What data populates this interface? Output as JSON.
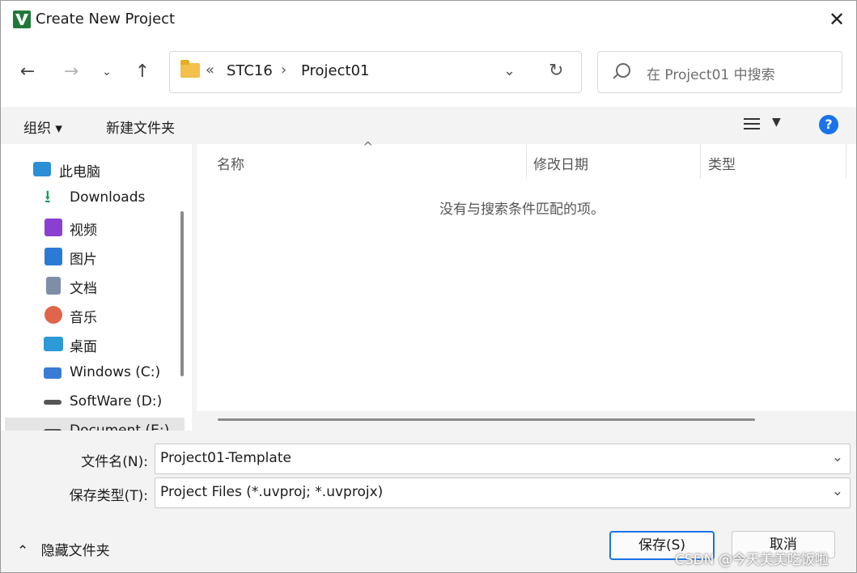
{
  "window": {
    "title": "Create New Project"
  },
  "address": {
    "overflow": "«",
    "crumbs": [
      "STC16",
      "Project01"
    ],
    "separator": "›"
  },
  "search": {
    "placeholder": "在 Project01 中搜索"
  },
  "toolbar": {
    "organize": "组织 ▾",
    "new_folder": "新建文件夹",
    "help": "?"
  },
  "tree": {
    "items": [
      {
        "label": "此电脑",
        "icon": "computer-icon",
        "color": "#2b8fd6"
      },
      {
        "label": "Downloads",
        "icon": "download-icon",
        "color": "#1a9c5b"
      },
      {
        "label": "视频",
        "icon": "video-icon",
        "color": "#8b3fd1"
      },
      {
        "label": "图片",
        "icon": "picture-icon",
        "color": "#2b7bd6"
      },
      {
        "label": "文档",
        "icon": "document-icon",
        "color": "#7d8ea6"
      },
      {
        "label": "音乐",
        "icon": "music-icon",
        "color": "#e0654a"
      },
      {
        "label": "桌面",
        "icon": "desktop-icon",
        "color": "#2b9ad6"
      },
      {
        "label": "Windows (C:)",
        "icon": "windows-drive-icon",
        "color": "#3a7bd5"
      },
      {
        "label": "SoftWare (D:)",
        "icon": "drive-icon",
        "color": "#555555"
      },
      {
        "label": "Document (E:)",
        "icon": "drive-icon",
        "color": "#555555"
      }
    ]
  },
  "filelist": {
    "columns": [
      "名称",
      "修改日期",
      "类型"
    ],
    "empty_message": "没有与搜索条件匹配的项。"
  },
  "form": {
    "filename_label": "文件名(N):",
    "filename_value": "Project01-Template",
    "filetype_label": "保存类型(T):",
    "filetype_value": "Project Files (*.uvproj; *.uvprojx)"
  },
  "footer": {
    "hide_folders": "隐藏文件夹",
    "save_label": "保存(S)",
    "cancel_label": "取消"
  },
  "watermark": "CSDN @今天美美吃饭啦"
}
